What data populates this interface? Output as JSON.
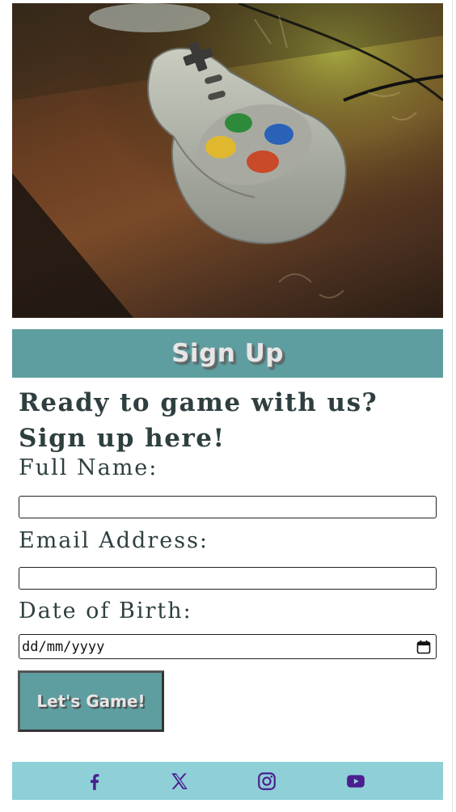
{
  "hero": {
    "image": "gamepad-on-wooden-table-photo"
  },
  "banner": {
    "title": "Sign Up"
  },
  "form": {
    "heading_line1": "Ready to game with us?",
    "heading_line2": "Sign up here!",
    "full_name_label": "Full Name:",
    "full_name_value": "",
    "email_label": "Email Address:",
    "email_value": "",
    "dob_label": "Date of Birth:",
    "dob_placeholder": "dd/mm/yyyy",
    "submit_label": "Let's Game!"
  },
  "footer": {
    "icons": [
      "facebook-icon",
      "x-icon",
      "instagram-icon",
      "youtube-icon"
    ],
    "icon_color": "#4b1e8f"
  },
  "colors": {
    "accent": "#5f9ea0",
    "footer_bg": "#8ecfd8",
    "text": "#2f3f40"
  }
}
